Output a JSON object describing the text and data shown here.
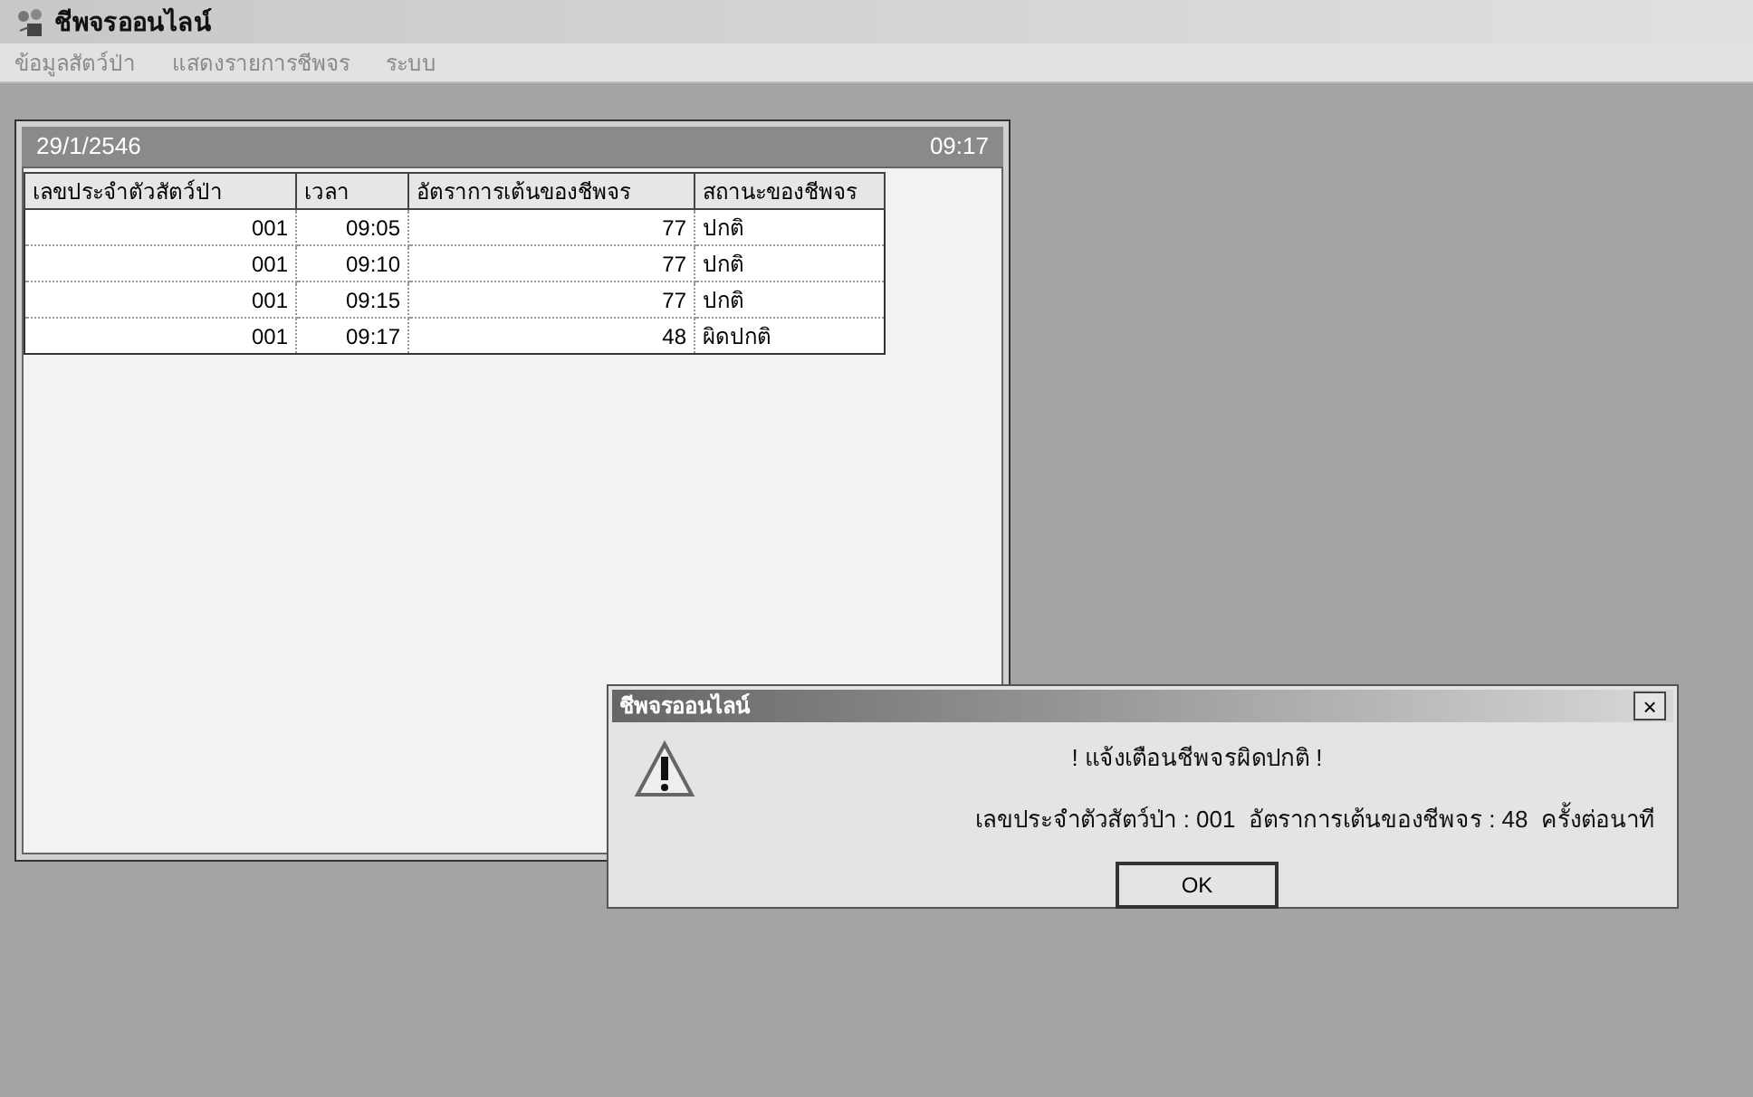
{
  "window": {
    "title": "ชีพจรออนไลน์"
  },
  "menu": [
    "ข้อมูลสัตว์ป่า",
    "แสดงรายการชีพจร",
    "ระบบ"
  ],
  "child_window": {
    "date": "29/1/2546",
    "time": "09:17"
  },
  "table": {
    "columns": [
      "เลขประจำตัวสัตว์ป่า",
      "เวลา",
      "อัตราการเต้นของชีพจร",
      "สถานะของชีพจร"
    ],
    "rows": [
      {
        "id": "001",
        "time": "09:05",
        "rate": "77",
        "status": "ปกติ"
      },
      {
        "id": "001",
        "time": "09:10",
        "rate": "77",
        "status": "ปกติ"
      },
      {
        "id": "001",
        "time": "09:15",
        "rate": "77",
        "status": "ปกติ"
      },
      {
        "id": "001",
        "time": "09:17",
        "rate": "48",
        "status": "ผิดปกติ"
      }
    ]
  },
  "dialog": {
    "title": "ชีพจรออนไลน์",
    "close": "×",
    "heading": "! แจ้งเตือนชีพจรผิดปกติ !",
    "message": "เลขประจำตัวสัตว์ป่า : 001  อัตราการเต้นของชีพจร : 48  ครั้งต่อนาที",
    "button": "OK"
  }
}
